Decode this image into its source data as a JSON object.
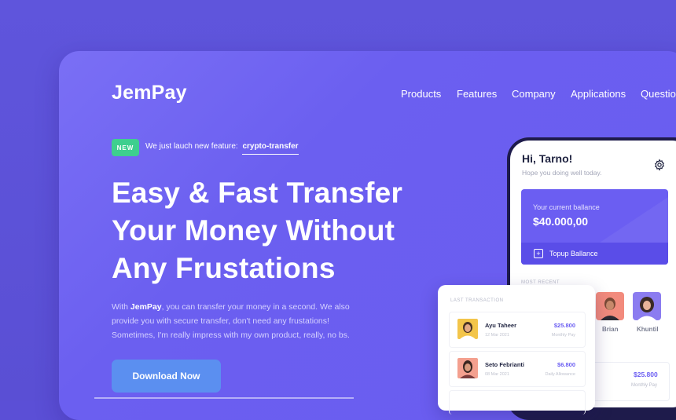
{
  "brand": {
    "name": "JemPay"
  },
  "nav": {
    "items": [
      "Products",
      "Features",
      "Company",
      "Applications",
      "Questions"
    ]
  },
  "announcement": {
    "badge": "NEW",
    "text": "We just lauch new feature:",
    "link": "crypto-transfer"
  },
  "hero": {
    "headline": [
      "Easy & Fast Transfer",
      "Your Money Without",
      "Any Frustations"
    ],
    "para_prefix": "With ",
    "para_brand": "JemPay",
    "para_rest": ", you can transfer your money in a second. We also provide you with secure transfer, don't need any frustations! Sometimes, I'm really impress with my own product, really, no bs.",
    "cta": "Download Now"
  },
  "phone": {
    "greeting": "Hi, Tarno!",
    "subtitle": "Hope you doing well today.",
    "balance_label": "Your current ballance",
    "balance_value": "$40.000,00",
    "topup_label": "Topup Ballance",
    "recent_label": "MOST RECENT",
    "recent": [
      {
        "name": "Brian"
      },
      {
        "name": "Khuntil"
      }
    ],
    "card_amount": "$25.800",
    "card_sub": "Monthly Pay"
  },
  "transactions": {
    "label": "LAST TRANSACTION",
    "rows": [
      {
        "name": "Ayu Taheer",
        "date": "12 Mar 2021",
        "amount": "$25.800",
        "sub": "Monthly Pay"
      },
      {
        "name": "Seto Febrianti",
        "date": "08 Mar 2021",
        "amount": "$6.800",
        "sub": "Daily Allowance"
      }
    ]
  },
  "colors": {
    "background": "#5b4fd6",
    "accent": "#6b5ef2",
    "badge": "#3ecf8e",
    "button": "#5b8ff0"
  }
}
